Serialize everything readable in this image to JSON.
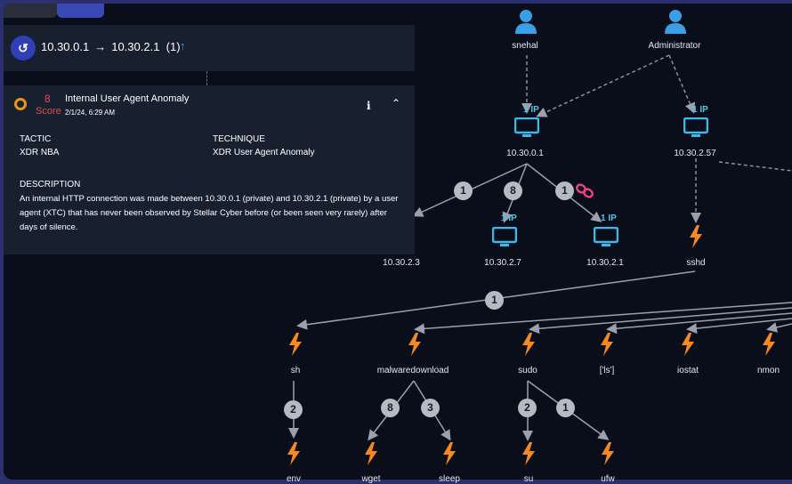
{
  "panel": {
    "path_src": "10.30.0.1",
    "path_dst": "10.30.2.1",
    "path_count": "(1)",
    "event": {
      "score": "8",
      "score_label": "Score",
      "title": "Internal User Agent Anomaly",
      "time": "2/1/24, 6:29 AM",
      "tactic_header": "TACTIC",
      "tactic_value": "XDR NBA",
      "technique_header": "TECHNIQUE",
      "technique_value": "XDR User Agent Anomaly",
      "description_header": "DESCRIPTION",
      "description": "An internal HTTP connection was made between 10.30.0.1 (private) and 10.30.2.1 (private) by a user agent (XTC) that has never been observed by Stellar Cyber before (or been seen very rarely) after days of silence."
    }
  },
  "graph": {
    "users": [
      "snehal",
      "Administrator"
    ],
    "hosts": [
      "10.30.0.1",
      "10.30.2.57"
    ],
    "host_badges": [
      "1 IP",
      "1 IP"
    ],
    "targets": [
      "10.30.2.3",
      "10.30.2.7",
      "10.30.2.1"
    ],
    "target_badges": [
      "1 IP",
      "1 IP"
    ],
    "target_counts": [
      "1",
      "8",
      "1"
    ],
    "sshd": "sshd",
    "sshd_count": "1",
    "processes": [
      "sh",
      "malwaredownload",
      "sudo",
      "['ls']",
      "iostat",
      "nmon"
    ],
    "child_counts": [
      "2",
      "8",
      "3",
      "2",
      "1"
    ],
    "children": [
      "env",
      "wget",
      "sleep",
      "su",
      "ufw"
    ],
    "colors": {
      "process": "#f6891f",
      "user": "#3a9fe6",
      "host": "#3fb9e8",
      "link": "#e8437a"
    }
  }
}
